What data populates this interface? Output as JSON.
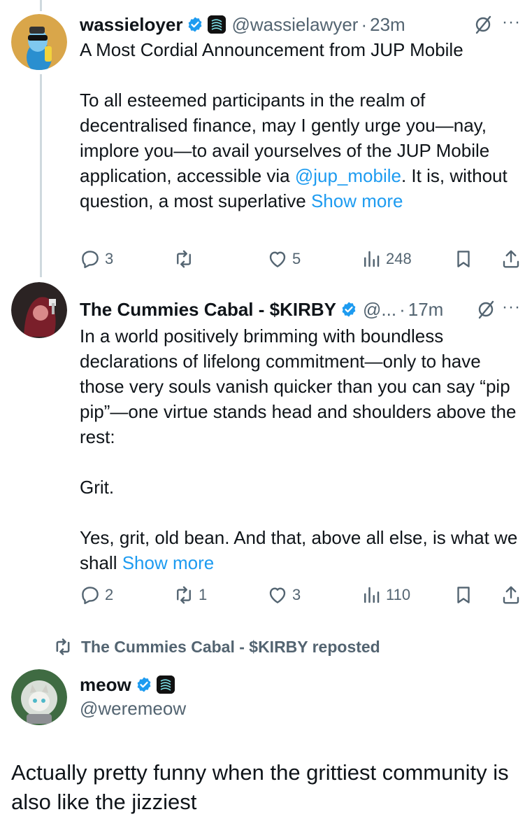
{
  "colors": {
    "link": "#1d9bf0",
    "verified": "#1d9bf0",
    "secondary_text": "#536471",
    "thread_line": "#cfd9de"
  },
  "tweets": [
    {
      "name": "wassieloyer",
      "handle": "@wassielawyer",
      "dot": "·",
      "time": "23m",
      "more": "···",
      "paragraphs": [
        "A Most Cordial Announcement from JUP Mobile",
        "To all esteemed participants in the realm of decentralised finance, may I gently urge you—nay, implore you—to avail yourselves of the JUP Mobile application, accessible via "
      ],
      "mention": "@jup_mobile",
      "after_mention": ". It is, without question, a most superlative ",
      "show_more": "Show more",
      "stats": {
        "replies": "3",
        "reposts": "",
        "likes": "5",
        "views": "248"
      }
    },
    {
      "name": "The Cummies Cabal - $KIRBY",
      "handle": "@...",
      "dot": "·",
      "time": "17m",
      "more": "···",
      "paragraphs": [
        "In a world positively brimming with boundless declarations of lifelong commitment—only to have those very souls vanish quicker than you can say “pip pip”—one virtue stands head and shoulders above the rest:",
        "Grit.",
        "Yes, grit, old bean. And that, above all else, is what we shall "
      ],
      "show_more": "Show more",
      "stats": {
        "replies": "2",
        "reposts": "1",
        "likes": "3",
        "views": "110"
      }
    }
  ],
  "repost_banner": "The Cummies Cabal - $KIRBY reposted",
  "quoted": {
    "name": "meow",
    "handle": "@weremeow"
  },
  "main_text": "Actually pretty funny when the grittiest community is also like the jizziest",
  "icons": [
    "reply-icon",
    "repost-icon",
    "like-icon",
    "views-icon",
    "bookmark-icon",
    "share-icon",
    "verified-badge-icon",
    "affiliate-badge-icon",
    "grok-icon",
    "more-icon"
  ]
}
